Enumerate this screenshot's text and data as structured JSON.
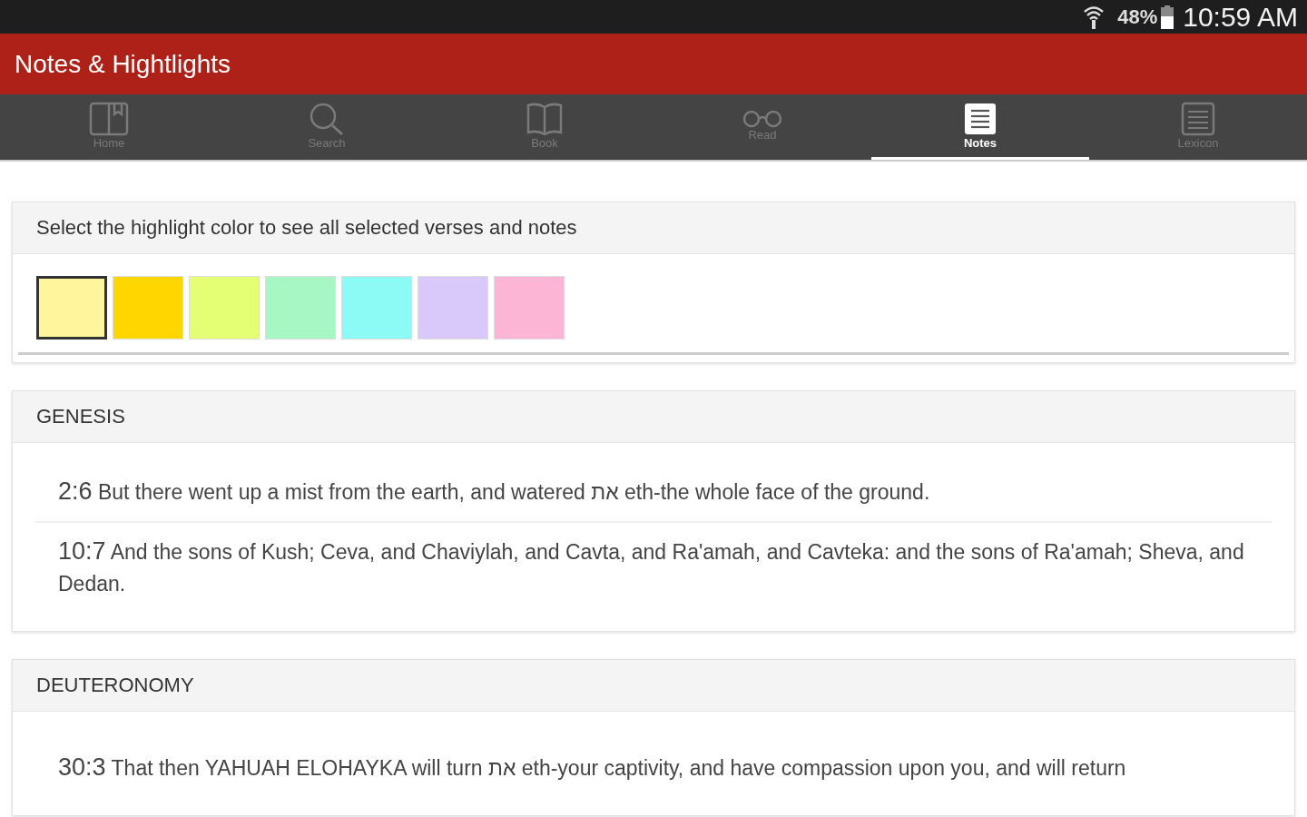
{
  "status_bar": {
    "battery": "48%",
    "time": "10:59 AM"
  },
  "app_bar": {
    "title": "Notes & Hightlights"
  },
  "tabs": [
    {
      "label": "Home",
      "kind": "home",
      "selected": false
    },
    {
      "label": "Search",
      "kind": "search",
      "selected": false
    },
    {
      "label": "Book",
      "kind": "book",
      "selected": false
    },
    {
      "label": "Read",
      "kind": "read",
      "selected": false
    },
    {
      "label": "Notes",
      "kind": "notes",
      "selected": true
    },
    {
      "label": "Lexicon",
      "kind": "lexicon",
      "selected": false
    }
  ],
  "palette": {
    "heading": "Select the highlight color to see all selected verses and notes",
    "swatches": [
      {
        "color": "#fff59d",
        "selected": true
      },
      {
        "color": "#ffd600",
        "selected": false
      },
      {
        "color": "#e4ff73",
        "selected": false
      },
      {
        "color": "#a6f7c4",
        "selected": false
      },
      {
        "color": "#8cfaf5",
        "selected": false
      },
      {
        "color": "#d9c8fa",
        "selected": false
      },
      {
        "color": "#fcb5d5",
        "selected": false
      }
    ]
  },
  "books": [
    {
      "name": "GENESIS",
      "verses": [
        {
          "ref": "2:6",
          "text": "But there went up a mist from the earth, and watered את eth-the whole face of the ground."
        },
        {
          "ref": "10:7",
          "text": "And the sons of Kush; Ceva, and Chaviylah, and Cavta, and Ra'amah, and Cavteka: and the sons of Ra'amah; Sheva, and Dedan."
        }
      ]
    },
    {
      "name": "DEUTERONOMY",
      "verses": [
        {
          "ref": "30:3",
          "text": "That then YAHUAH ELOHAYKA will turn את eth-your captivity, and have compassion upon you, and will return"
        }
      ]
    }
  ]
}
